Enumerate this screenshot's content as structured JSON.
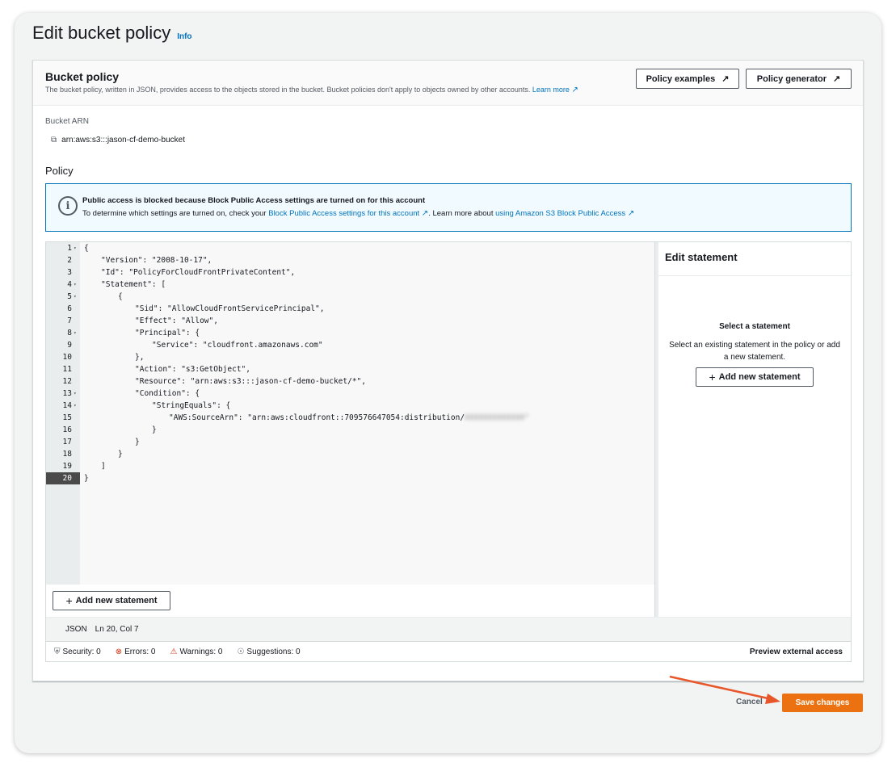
{
  "page": {
    "title": "Edit bucket policy",
    "info": "Info"
  },
  "bucket_policy": {
    "title": "Bucket policy",
    "description": "The bucket policy, written in JSON, provides access to the objects stored in the bucket. Bucket policies don't apply to objects owned by other accounts.",
    "learn_more": "Learn more",
    "policy_examples_button": "Policy examples",
    "policy_generator_button": "Policy generator",
    "external_link_icon": "external-link-icon"
  },
  "bucket_arn": {
    "label": "Bucket ARN",
    "value": "arn:aws:s3:::jason-cf-demo-bucket",
    "copy_icon": "copy-icon"
  },
  "policy": {
    "label": "Policy"
  },
  "alert": {
    "icon": "info-icon",
    "title": "Public access is blocked because Block Public Access settings are turned on for this account",
    "body_prefix": "To determine which settings are turned on, check your",
    "body_link1": "Block Public Access settings for this account",
    "body_middle": ". Learn more about",
    "body_link2": "using Amazon S3 Block Public Access"
  },
  "editor": {
    "lines": [
      {
        "n": "1",
        "fold": true,
        "indent": 0,
        "text": "{"
      },
      {
        "n": "2",
        "fold": false,
        "indent": 1,
        "text": "\"Version\": \"2008-10-17\","
      },
      {
        "n": "3",
        "fold": false,
        "indent": 1,
        "text": "\"Id\": \"PolicyForCloudFrontPrivateContent\","
      },
      {
        "n": "4",
        "fold": true,
        "indent": 1,
        "text": "\"Statement\": ["
      },
      {
        "n": "5",
        "fold": true,
        "indent": 2,
        "text": "{"
      },
      {
        "n": "6",
        "fold": false,
        "indent": 3,
        "text": "\"Sid\": \"AllowCloudFrontServicePrincipal\","
      },
      {
        "n": "7",
        "fold": false,
        "indent": 3,
        "text": "\"Effect\": \"Allow\","
      },
      {
        "n": "8",
        "fold": true,
        "indent": 3,
        "text": "\"Principal\": {"
      },
      {
        "n": "9",
        "fold": false,
        "indent": 4,
        "text": "\"Service\": \"cloudfront.amazonaws.com\""
      },
      {
        "n": "10",
        "fold": false,
        "indent": 3,
        "text": "},"
      },
      {
        "n": "11",
        "fold": false,
        "indent": 3,
        "text": "\"Action\": \"s3:GetObject\","
      },
      {
        "n": "12",
        "fold": false,
        "indent": 3,
        "text": "\"Resource\": \"arn:aws:s3:::jason-cf-demo-bucket/*\","
      },
      {
        "n": "13",
        "fold": true,
        "indent": 3,
        "text": "\"Condition\": {"
      },
      {
        "n": "14",
        "fold": true,
        "indent": 4,
        "text": "\"StringEquals\": {"
      },
      {
        "n": "15",
        "fold": false,
        "indent": 5,
        "text": "\"AWS:SourceArn\": \"arn:aws:cloudfront::709576647054:distribution/",
        "blurred": "XXXXXXXXXXXXX\""
      },
      {
        "n": "16",
        "fold": false,
        "indent": 4,
        "text": "}"
      },
      {
        "n": "17",
        "fold": false,
        "indent": 3,
        "text": "}"
      },
      {
        "n": "18",
        "fold": false,
        "indent": 2,
        "text": "}"
      },
      {
        "n": "19",
        "fold": false,
        "indent": 1,
        "text": "]"
      },
      {
        "n": "20",
        "fold": false,
        "indent": 0,
        "text": "}",
        "active": true
      }
    ],
    "add_statement_button": "Add new statement",
    "status_lang": "JSON",
    "status_pos": "Ln 20, Col 7"
  },
  "side_panel": {
    "title": "Edit statement",
    "subtitle": "Select a statement",
    "description": "Select an existing statement in the policy or add a new statement.",
    "add_statement_button": "Add new statement"
  },
  "checks": {
    "security": "Security: 0",
    "errors": "Errors: 0",
    "warnings": "Warnings: 0",
    "suggestions": "Suggestions: 0",
    "preview": "Preview external access"
  },
  "footer": {
    "cancel": "Cancel",
    "save": "Save changes"
  },
  "colors": {
    "primary_button": "#ec7211",
    "link": "#0073bb",
    "annotation_arrow": "#e8572a"
  }
}
